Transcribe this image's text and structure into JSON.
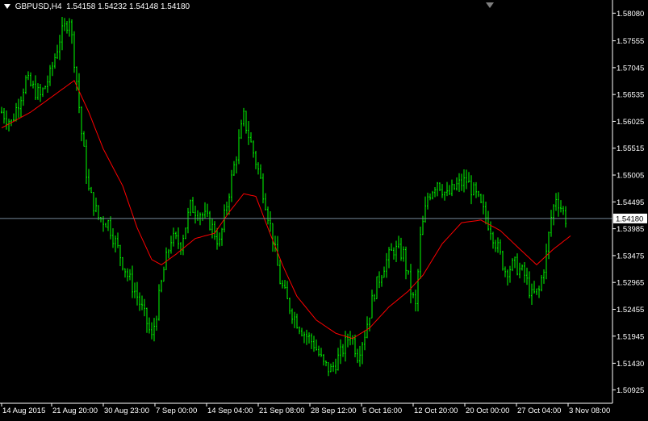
{
  "header": {
    "symbol": "GBPUSD,H4",
    "open": "1.54158",
    "high": "1.54232",
    "low": "1.54148",
    "close": "1.54180"
  },
  "colors": {
    "background": "#000000",
    "bars": "#00ff00",
    "moving_average": "#ff0000",
    "axis": "#ffffff",
    "bid_line": "#778899",
    "price_label_bg": "#ffffff",
    "price_label_text": "#000000"
  },
  "icons": {
    "header_menu": "triangle-down-icon",
    "chart_shift": "triangle-down-icon"
  },
  "chart_data": {
    "type": "ohlc",
    "title": "",
    "timeframe": "H4",
    "grid": false,
    "ylim": [
      1.5067,
      1.5833
    ],
    "y_ticks": [
      "1.58080",
      "1.57555",
      "1.57045",
      "1.56535",
      "1.56025",
      "1.55515",
      "1.55005",
      "1.54495",
      "1.53985",
      "1.53475",
      "1.52965",
      "1.52455",
      "1.51945",
      "1.51430",
      "1.50925"
    ],
    "x_ticks": [
      "14 Aug 2015",
      "21 Aug 20:00",
      "30 Aug 23:00",
      "7 Sep 00:00",
      "14 Sep 04:00",
      "21 Sep 08:00",
      "28 Sep 12:00",
      "5 Oct 16:00",
      "12 Oct 20:00",
      "20 Oct 00:00",
      "27 Oct 04:00",
      "3 Nov 08:00"
    ],
    "bid_price": "1.54180",
    "price_path_approx": [
      {
        "t": 0,
        "p": 1.562
      },
      {
        "t": 4,
        "p": 1.56
      },
      {
        "t": 10,
        "p": 1.568
      },
      {
        "t": 16,
        "p": 1.565
      },
      {
        "t": 20,
        "p": 1.569
      },
      {
        "t": 24,
        "p": 1.576
      },
      {
        "t": 28,
        "p": 1.58
      },
      {
        "t": 31,
        "p": 1.568
      },
      {
        "t": 33,
        "p": 1.558
      },
      {
        "t": 36,
        "p": 1.547
      },
      {
        "t": 40,
        "p": 1.542
      },
      {
        "t": 44,
        "p": 1.541
      },
      {
        "t": 48,
        "p": 1.536
      },
      {
        "t": 52,
        "p": 1.531
      },
      {
        "t": 56,
        "p": 1.527
      },
      {
        "t": 60,
        "p": 1.522
      },
      {
        "t": 62,
        "p": 1.519
      },
      {
        "t": 64,
        "p": 1.524
      },
      {
        "t": 67,
        "p": 1.532
      },
      {
        "t": 70,
        "p": 1.538
      },
      {
        "t": 74,
        "p": 1.537
      },
      {
        "t": 78,
        "p": 1.544
      },
      {
        "t": 82,
        "p": 1.543
      },
      {
        "t": 86,
        "p": 1.541
      },
      {
        "t": 90,
        "p": 1.537
      },
      {
        "t": 94,
        "p": 1.547
      },
      {
        "t": 97,
        "p": 1.554
      },
      {
        "t": 100,
        "p": 1.561
      },
      {
        "t": 103,
        "p": 1.556
      },
      {
        "t": 106,
        "p": 1.551
      },
      {
        "t": 109,
        "p": 1.545
      },
      {
        "t": 112,
        "p": 1.538
      },
      {
        "t": 115,
        "p": 1.53
      },
      {
        "t": 118,
        "p": 1.526
      },
      {
        "t": 121,
        "p": 1.523
      },
      {
        "t": 125,
        "p": 1.52
      },
      {
        "t": 129,
        "p": 1.518
      },
      {
        "t": 133,
        "p": 1.514
      },
      {
        "t": 136,
        "p": 1.513
      },
      {
        "t": 140,
        "p": 1.516
      },
      {
        "t": 144,
        "p": 1.52
      },
      {
        "t": 147,
        "p": 1.516
      },
      {
        "t": 150,
        "p": 1.52
      },
      {
        "t": 154,
        "p": 1.528
      },
      {
        "t": 158,
        "p": 1.533
      },
      {
        "t": 162,
        "p": 1.536
      },
      {
        "t": 166,
        "p": 1.535
      },
      {
        "t": 169,
        "p": 1.528
      },
      {
        "t": 171,
        "p": 1.525
      },
      {
        "t": 173,
        "p": 1.538
      },
      {
        "t": 176,
        "p": 1.546
      },
      {
        "t": 180,
        "p": 1.549
      },
      {
        "t": 184,
        "p": 1.546
      },
      {
        "t": 188,
        "p": 1.548
      },
      {
        "t": 192,
        "p": 1.549
      },
      {
        "t": 196,
        "p": 1.546
      },
      {
        "t": 199,
        "p": 1.543
      },
      {
        "t": 202,
        "p": 1.54
      },
      {
        "t": 205,
        "p": 1.536
      },
      {
        "t": 208,
        "p": 1.532
      },
      {
        "t": 212,
        "p": 1.533
      },
      {
        "t": 216,
        "p": 1.531
      },
      {
        "t": 219,
        "p": 1.527
      },
      {
        "t": 222,
        "p": 1.528
      },
      {
        "t": 225,
        "p": 1.535
      },
      {
        "t": 227,
        "p": 1.542
      },
      {
        "t": 229,
        "p": 1.546
      },
      {
        "t": 231,
        "p": 1.544
      },
      {
        "t": 233,
        "p": 1.5418
      }
    ],
    "moving_average_path_approx": [
      {
        "t": 0,
        "p": 1.559
      },
      {
        "t": 12,
        "p": 1.562
      },
      {
        "t": 24,
        "p": 1.566
      },
      {
        "t": 30,
        "p": 1.568
      },
      {
        "t": 36,
        "p": 1.562
      },
      {
        "t": 42,
        "p": 1.555
      },
      {
        "t": 50,
        "p": 1.548
      },
      {
        "t": 56,
        "p": 1.54
      },
      {
        "t": 62,
        "p": 1.534
      },
      {
        "t": 66,
        "p": 1.533
      },
      {
        "t": 72,
        "p": 1.535
      },
      {
        "t": 80,
        "p": 1.538
      },
      {
        "t": 88,
        "p": 1.539
      },
      {
        "t": 94,
        "p": 1.543
      },
      {
        "t": 100,
        "p": 1.5465
      },
      {
        "t": 105,
        "p": 1.546
      },
      {
        "t": 110,
        "p": 1.54
      },
      {
        "t": 116,
        "p": 1.533
      },
      {
        "t": 122,
        "p": 1.527
      },
      {
        "t": 130,
        "p": 1.5225
      },
      {
        "t": 138,
        "p": 1.52
      },
      {
        "t": 145,
        "p": 1.519
      },
      {
        "t": 152,
        "p": 1.521
      },
      {
        "t": 160,
        "p": 1.525
      },
      {
        "t": 168,
        "p": 1.528
      },
      {
        "t": 174,
        "p": 1.531
      },
      {
        "t": 182,
        "p": 1.537
      },
      {
        "t": 190,
        "p": 1.541
      },
      {
        "t": 198,
        "p": 1.5415
      },
      {
        "t": 206,
        "p": 1.5395
      },
      {
        "t": 214,
        "p": 1.536
      },
      {
        "t": 221,
        "p": 1.533
      },
      {
        "t": 228,
        "p": 1.536
      },
      {
        "t": 235,
        "p": 1.5385
      }
    ]
  }
}
